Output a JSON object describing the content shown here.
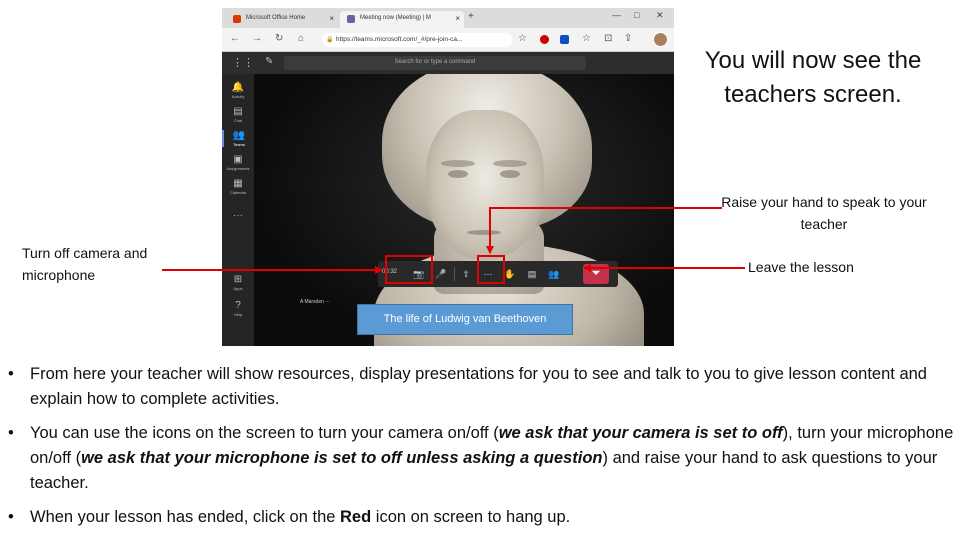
{
  "browser": {
    "tab1": {
      "title": "Microsoft Office Home"
    },
    "tab2": {
      "title": "Meeting now (Meeting) | M"
    },
    "new_tab": "+",
    "url": "https://teams.microsoft.com/_#/pre-join-ca...",
    "window_controls": [
      "—",
      "□",
      "✕"
    ]
  },
  "teams": {
    "search_placeholder": "Search for or type a command",
    "rail": [
      {
        "icon": "bell-icon",
        "glyph": "🔔",
        "label": "Activity"
      },
      {
        "icon": "chat-icon",
        "glyph": "▤",
        "label": "Chat"
      },
      {
        "icon": "teams-icon",
        "glyph": "👥",
        "label": "Teams"
      },
      {
        "icon": "assignments-icon",
        "glyph": "▣",
        "label": "Assignments"
      },
      {
        "icon": "calendar-icon",
        "glyph": "▦",
        "label": "Calendar"
      },
      {
        "icon": "more-icon",
        "glyph": "···",
        "label": ""
      },
      {
        "icon": "apps-icon",
        "glyph": "⊞",
        "label": "Apps"
      },
      {
        "icon": "help-icon",
        "glyph": "?",
        "label": "Help"
      }
    ],
    "meeting_timer": "00:32",
    "participant_name": "A Marsden",
    "participant_more": "···"
  },
  "banner": "The life of Ludwig van Beethoven",
  "callouts": {
    "teacher_screen": "You will now see the teachers screen.",
    "raise_hand": "Raise your hand to speak to your teacher",
    "leave": "Leave the lesson",
    "camera_mic": "Turn off camera and microphone"
  },
  "bullets": {
    "b1": "From here your teacher will show resources, display presentations for you to see and talk to you to give lesson content and explain how to complete activities.",
    "b2_a": "You can use the icons on the screen to turn your camera on/off (",
    "b2_em1": "we ask that your camera is set to off",
    "b2_b": "), turn your microphone on/off (",
    "b2_em2": "we ask that your microphone is set to off unless asking a question",
    "b2_c": ") and raise your hand to ask questions to your teacher.",
    "b3_a": "When your lesson has ended, click on the ",
    "b3_strong": "Red",
    "b3_b": " icon on screen to hang up.",
    "marker": "•"
  },
  "colors": {
    "highlight": "#e00000",
    "hangup": "#c4314b",
    "banner": "#5b9bd5",
    "teams_accent": "#7b83eb"
  }
}
